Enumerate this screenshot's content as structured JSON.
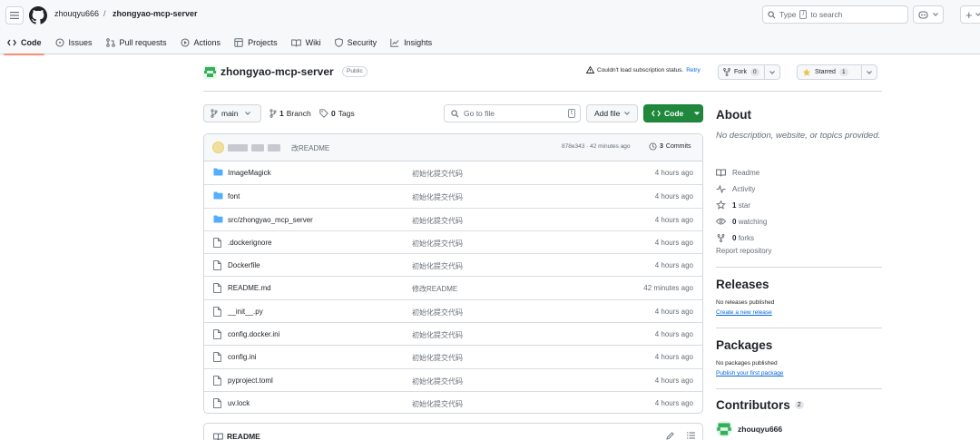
{
  "header": {
    "owner": "zhouqyu666",
    "separator": "/",
    "repo": "zhongyao-mcp-server",
    "search_prefix": "Type",
    "search_key": "/",
    "search_suffix": "to search"
  },
  "nav_tabs": [
    {
      "label": "Code",
      "icon": "code-icon",
      "active": true
    },
    {
      "label": "Issues",
      "icon": "issue-icon"
    },
    {
      "label": "Pull requests",
      "icon": "pull-request-icon"
    },
    {
      "label": "Actions",
      "icon": "play-icon"
    },
    {
      "label": "Projects",
      "icon": "table-icon"
    },
    {
      "label": "Wiki",
      "icon": "book-icon"
    },
    {
      "label": "Security",
      "icon": "shield-icon"
    },
    {
      "label": "Insights",
      "icon": "graph-icon"
    }
  ],
  "repo": {
    "title": "zhongyao-mcp-server",
    "visibility": "Public",
    "warning": "Couldn't load subscription status.",
    "retry": "Retry",
    "fork_label": "Fork",
    "fork_count": "0",
    "star_label": "Starred",
    "star_count": "1"
  },
  "file_nav": {
    "branch": "main",
    "branch_count": "1",
    "branch_label": "Branch",
    "tag_count": "0",
    "tag_label": "Tags",
    "goto_placeholder": "Go to file",
    "goto_key": "t",
    "add_file": "Add file",
    "code": "Code"
  },
  "latest_commit": {
    "message": "改README",
    "hash": "878e343",
    "age": "42 minutes ago",
    "commit_count": "3",
    "commit_label": "Commits"
  },
  "files": [
    {
      "name": "ImageMagick",
      "type": "dir",
      "message": "初始化提交代码",
      "time": "4 hours ago"
    },
    {
      "name": "font",
      "type": "dir",
      "message": "初始化提交代码",
      "time": "4 hours ago"
    },
    {
      "name": "src/zhongyao_mcp_server",
      "type": "dir",
      "message": "初始化提交代码",
      "time": "4 hours ago"
    },
    {
      "name": ".dockerignore",
      "type": "file",
      "message": "初始化提交代码",
      "time": "4 hours ago"
    },
    {
      "name": "Dockerfile",
      "type": "file",
      "message": "初始化提交代码",
      "time": "4 hours ago"
    },
    {
      "name": "README.md",
      "type": "file",
      "message": "修改README",
      "time": "42 minutes ago"
    },
    {
      "name": "__init__.py",
      "type": "file",
      "message": "初始化提交代码",
      "time": "4 hours ago"
    },
    {
      "name": "config.docker.ini",
      "type": "file",
      "message": "初始化提交代码",
      "time": "4 hours ago"
    },
    {
      "name": "config.ini",
      "type": "file",
      "message": "初始化提交代码",
      "time": "4 hours ago"
    },
    {
      "name": "pyproject.toml",
      "type": "file",
      "message": "初始化提交代码",
      "time": "4 hours ago"
    },
    {
      "name": "uv.lock",
      "type": "file",
      "message": "初始化提交代码",
      "time": "4 hours ago"
    }
  ],
  "readme": {
    "title": "README"
  },
  "about": {
    "heading": "About",
    "description": "No description, website, or topics provided.",
    "readme": "Readme",
    "activity": "Activity",
    "stars_count": "1",
    "stars_label": "star",
    "watching_count": "0",
    "watching_label": "watching",
    "forks_count": "0",
    "forks_label": "forks",
    "report": "Report repository"
  },
  "releases": {
    "heading": "Releases",
    "empty": "No releases published",
    "link": "Create a new release"
  },
  "packages": {
    "heading": "Packages",
    "empty": "No packages published",
    "link": "Publish your first package"
  },
  "contributors": {
    "heading": "Contributors",
    "count": "2",
    "user": "zhouqyu666"
  },
  "colors": {
    "accent": "#1f883d",
    "tab_underline": "#fd8c73",
    "folder": "#54aeff",
    "link": "#0969da"
  }
}
